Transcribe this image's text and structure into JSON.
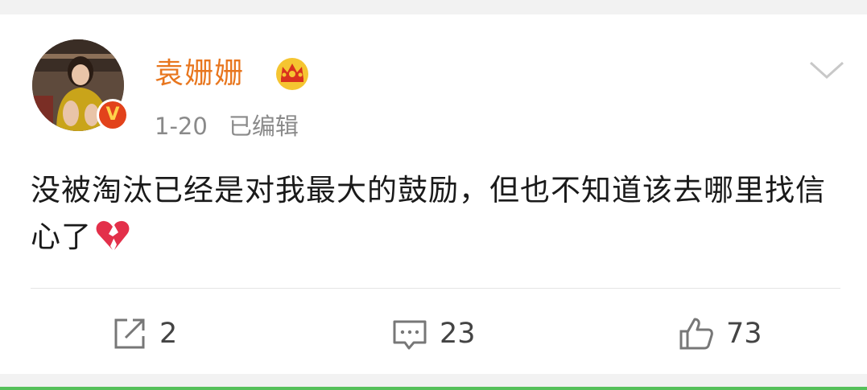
{
  "post": {
    "username": "袁姗姗",
    "date": "1-20",
    "edited": "已编辑",
    "text": "没被淘汰已经是对我最大的鼓励，但也不知道该去哪里找信心了",
    "badge": "V",
    "emoji": "broken-heart-icon"
  },
  "actions": {
    "forward_count": "2",
    "comment_count": "23",
    "like_count": "73"
  },
  "colors": {
    "username": "#e8761e",
    "badge": "#e2421b",
    "accent_line": "#55c05a"
  }
}
